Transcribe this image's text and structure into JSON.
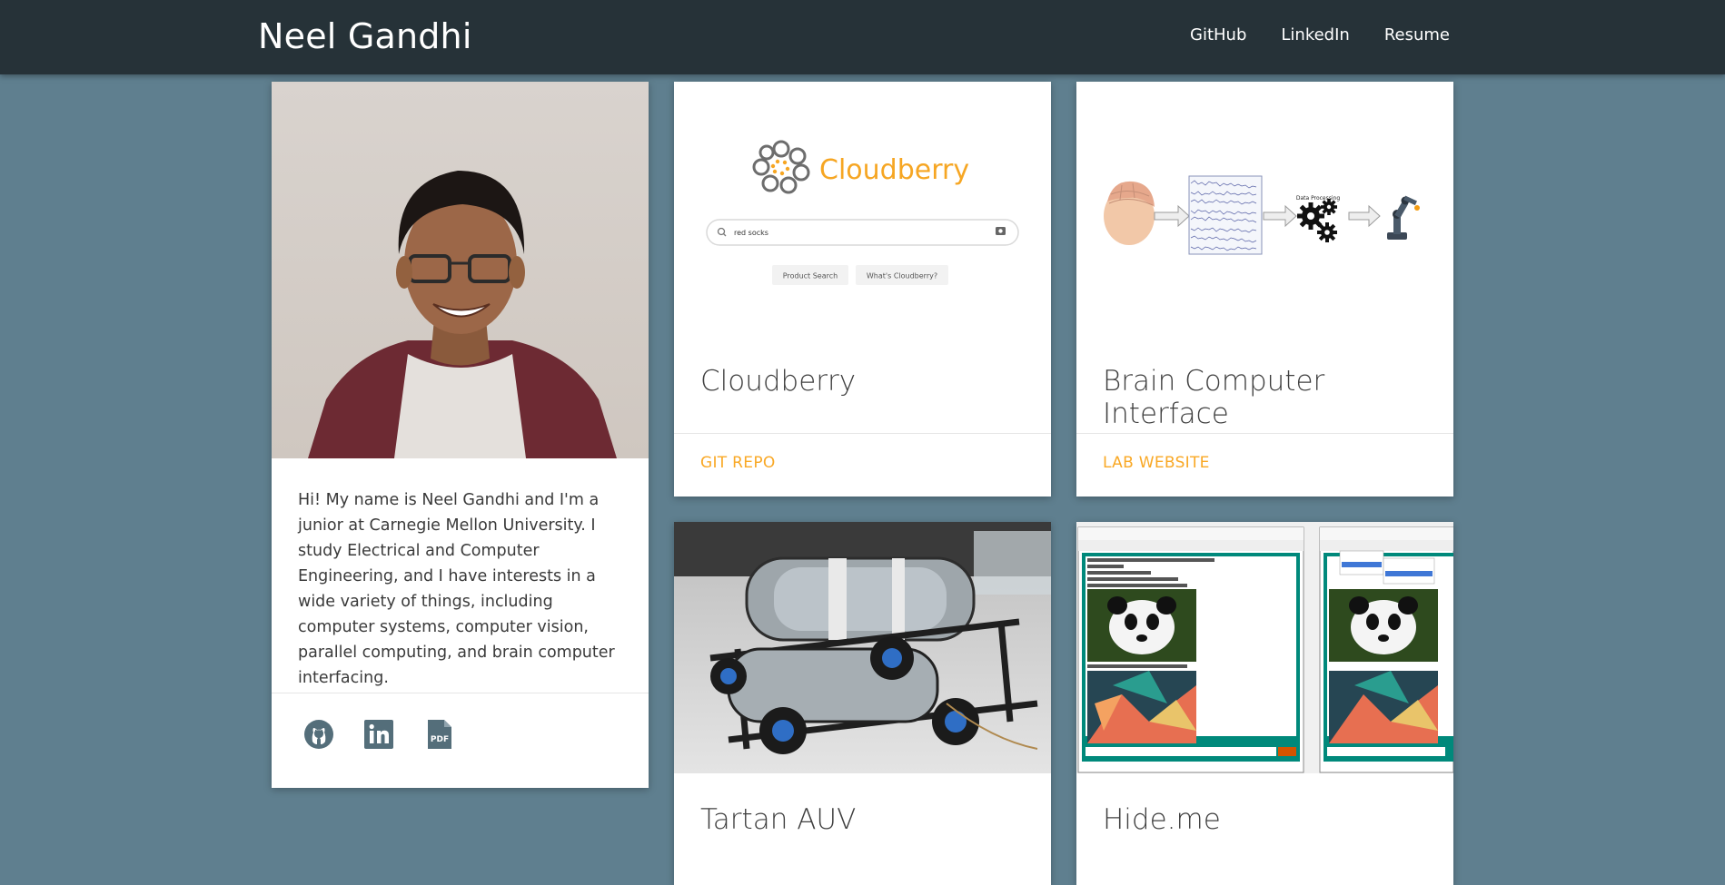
{
  "navbar": {
    "brand": "Neel Gandhi",
    "links": [
      {
        "label": "GitHub"
      },
      {
        "label": "LinkedIn"
      },
      {
        "label": "Resume"
      }
    ]
  },
  "profile": {
    "bio": "Hi! My name is Neel Gandhi and I'm a junior at Carnegie Mellon University. I study Electrical and Computer Engineering, and I have interests in a wide variety of things, including computer systems, computer vision, parallel computing, and brain computer interfacing.",
    "icons": [
      "github-icon",
      "linkedin-icon",
      "pdf-icon"
    ],
    "pdf_label": "PDF"
  },
  "projects": [
    {
      "title": "Cloudberry",
      "action": "GIT REPO",
      "image": {
        "logo_text": "Cloudberry",
        "search_value": "red socks",
        "buttons": [
          "Product Search",
          "What's Cloudberry?"
        ]
      }
    },
    {
      "title": "Brain Computer Interface",
      "action": "LAB WEBSITE",
      "image": {
        "stage_label": "Data Processing"
      }
    },
    {
      "title": "Tartan AUV",
      "action": ""
    },
    {
      "title": "Hide.me",
      "action": ""
    }
  ],
  "colors": {
    "navbar": "#263238",
    "background": "#5f7f8f",
    "accent": "#f9a825",
    "cloudberry_orange": "#f6a623"
  }
}
